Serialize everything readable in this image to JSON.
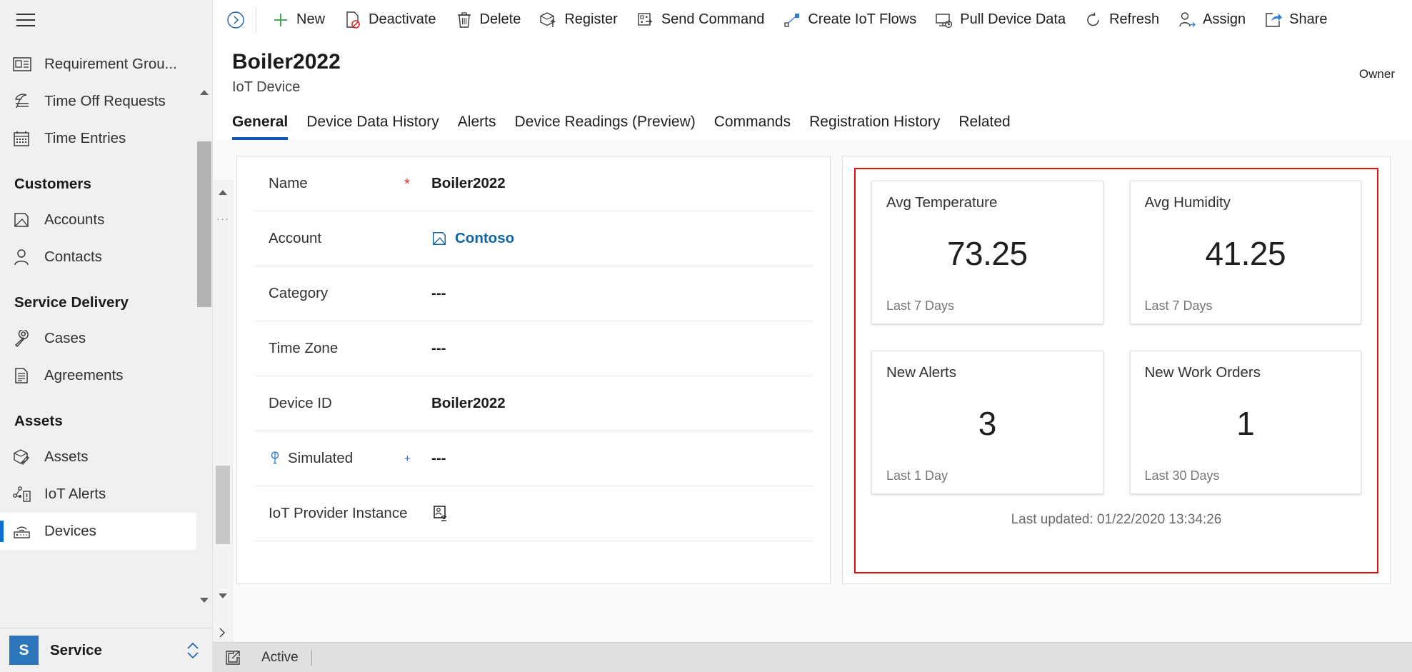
{
  "sidebar": {
    "hamburger_name": "site-map-toggle",
    "items_top": [
      {
        "label": "Requirement Grou...",
        "icon": "contact-card-icon"
      },
      {
        "label": "Time Off Requests",
        "icon": "beach-umbrella-icon"
      },
      {
        "label": "Time Entries",
        "icon": "calendar-icon"
      }
    ],
    "groups": [
      {
        "title": "Customers",
        "items": [
          {
            "label": "Accounts",
            "icon": "account-icon"
          },
          {
            "label": "Contacts",
            "icon": "contact-person-icon"
          }
        ]
      },
      {
        "title": "Service Delivery",
        "items": [
          {
            "label": "Cases",
            "icon": "wrench-icon"
          },
          {
            "label": "Agreements",
            "icon": "document-lines-icon"
          }
        ]
      },
      {
        "title": "Assets",
        "items": [
          {
            "label": "Assets",
            "icon": "package-pencil-icon"
          },
          {
            "label": "IoT Alerts",
            "icon": "iot-alert-icon"
          },
          {
            "label": "Devices",
            "icon": "device-signal-icon",
            "selected": true
          }
        ]
      }
    ],
    "footer": {
      "badge": "S",
      "app_name": "Service",
      "switcher_icon": "chevron-up-down-icon"
    }
  },
  "command_bar": {
    "back_icon": "circle-chevron-right-icon",
    "buttons": [
      {
        "label": "New",
        "icon": "plus-icon"
      },
      {
        "label": "Deactivate",
        "icon": "deactivate-page-icon"
      },
      {
        "label": "Delete",
        "icon": "trash-icon"
      },
      {
        "label": "Register",
        "icon": "package-up-icon"
      },
      {
        "label": "Send Command",
        "icon": "send-command-icon"
      },
      {
        "label": "Create IoT Flows",
        "icon": "flow-icon"
      },
      {
        "label": "Pull Device Data",
        "icon": "pull-data-icon"
      },
      {
        "label": "Refresh",
        "icon": "refresh-icon"
      },
      {
        "label": "Assign",
        "icon": "assign-person-icon"
      },
      {
        "label": "Share",
        "icon": "share-icon"
      }
    ]
  },
  "record": {
    "title": "Boiler2022",
    "subtitle": "IoT Device",
    "owner_label": "Owner"
  },
  "tabs": [
    {
      "label": "General",
      "active": true
    },
    {
      "label": "Device Data History",
      "active": false
    },
    {
      "label": "Alerts",
      "active": false
    },
    {
      "label": "Device Readings (Preview)",
      "active": false
    },
    {
      "label": "Commands",
      "active": false
    },
    {
      "label": "Registration History",
      "active": false
    },
    {
      "label": "Related",
      "active": false
    }
  ],
  "form": {
    "fields": [
      {
        "label": "Name",
        "value": "Boiler2022",
        "marker": "required",
        "kind": "text"
      },
      {
        "label": "Account",
        "value": "Contoso",
        "marker": "none",
        "kind": "lookup",
        "icon": "account-icon"
      },
      {
        "label": "Category",
        "value": "---",
        "marker": "none",
        "kind": "text"
      },
      {
        "label": "Time Zone",
        "value": "---",
        "marker": "none",
        "kind": "text"
      },
      {
        "label": "Device ID",
        "value": "Boiler2022",
        "marker": "none",
        "kind": "text"
      },
      {
        "label": "Simulated",
        "value": "---",
        "marker": "plus",
        "kind": "text",
        "label_icon": "lock-key-icon"
      },
      {
        "label": "IoT Provider Instance",
        "value": "",
        "marker": "none",
        "kind": "icon-only",
        "value_icon": "iot-provider-icon"
      }
    ]
  },
  "kpi": {
    "highlight_color": "#e31010",
    "tiles": [
      {
        "title": "Avg Temperature",
        "value": "73.25",
        "footer": "Last 7 Days"
      },
      {
        "title": "Avg Humidity",
        "value": "41.25",
        "footer": "Last 7 Days"
      },
      {
        "title": "New Alerts",
        "value": "3",
        "footer": "Last 1 Day"
      },
      {
        "title": "New Work Orders",
        "value": "1",
        "footer": "Last 30 Days"
      }
    ],
    "last_updated": "Last updated: 01/22/2020 13:34:26"
  },
  "status_bar": {
    "icon": "popout-icon",
    "text": "Active"
  }
}
